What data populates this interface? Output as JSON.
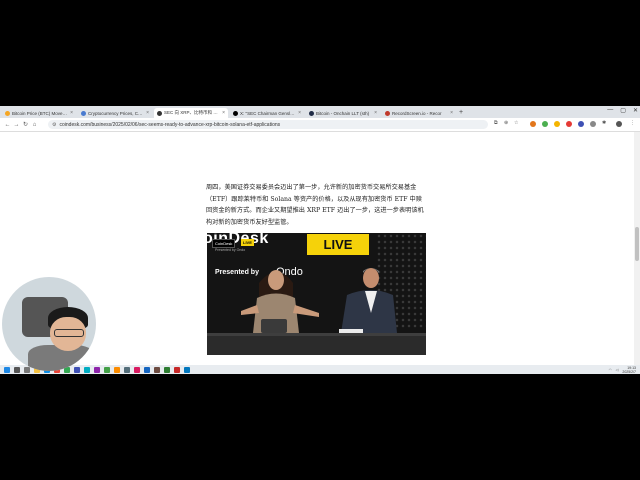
{
  "tabs": [
    {
      "title": "Bitcoin Price (BTC) Moves on",
      "color": "#f5a623"
    },
    {
      "title": "Cryptocurrency Prices, Char",
      "color": "#4a7bd0"
    },
    {
      "title": "SEC 向 XRP、比特币和 Solana ETF...",
      "color": "#333333"
    },
    {
      "title": "X: \"SEC Chairman Gensler\" / X",
      "color": "#000000"
    },
    {
      "title": "Bitcoin - Onchain LLT (sth)",
      "color": "#1f2b46"
    },
    {
      "title": "RecordScreen.io - Recor",
      "color": "#c0392b"
    }
  ],
  "browser": {
    "url": "coindesk.com/business/2025/02/06/sec-seems-ready-to-advance-xrp-bitcoin-solana-etf-applications",
    "back": "←",
    "forward": "→",
    "reload": "↻",
    "minimize": "—",
    "maximize": "▢",
    "close": "✕",
    "newtab": "+"
  },
  "article": {
    "paragraph": "周四，美国证券交易委员会迈出了第一步，允许新的加密货币交易所交易基金（ETF）跟踪莱特币和 Solana 等资产的价格，以及从现有加密货币 ETF 中赎回资金的新方式。而企业又期望推出 XRP ETF 迈出了一步，这进一步表明该机构对新的加密货币友好型监管。"
  },
  "video": {
    "brand": "oinDesk",
    "live": "LIVE",
    "badge_brand": "CoinDesk",
    "badge_live": "LIVE",
    "small_text": "Presented by Ondo",
    "presented_by": "Presented by",
    "sponsor": "Ondo"
  },
  "taskbar": {
    "time": "19:13",
    "date": "2025/2/7"
  }
}
